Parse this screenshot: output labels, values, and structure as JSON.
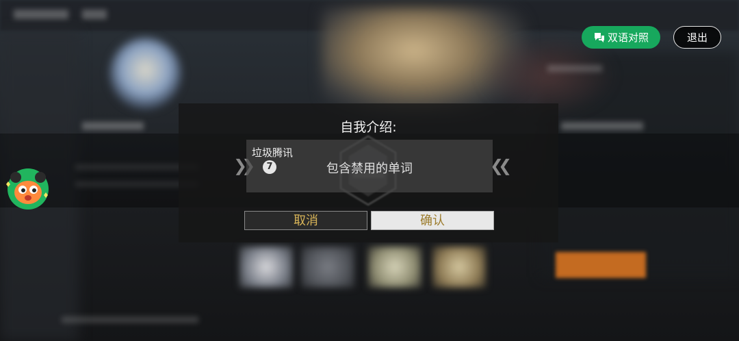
{
  "dialog": {
    "title": "自我介绍:",
    "input_value": "垃圾腾讯",
    "warning_badge": "7",
    "warning_text": "包含禁用的单词",
    "cancel_label": "取消",
    "confirm_label": "确认"
  },
  "toolbar": {
    "bilingual_label": "双语对照",
    "bilingual_icon": "translate-bubble-icon",
    "exit_label": "退出"
  },
  "assistant": {
    "icon": "mascot-icon"
  },
  "colors": {
    "bilingual_bg": "#17a85d",
    "button_text_gold": "#d8b458",
    "dialog_bg": "#161616"
  }
}
